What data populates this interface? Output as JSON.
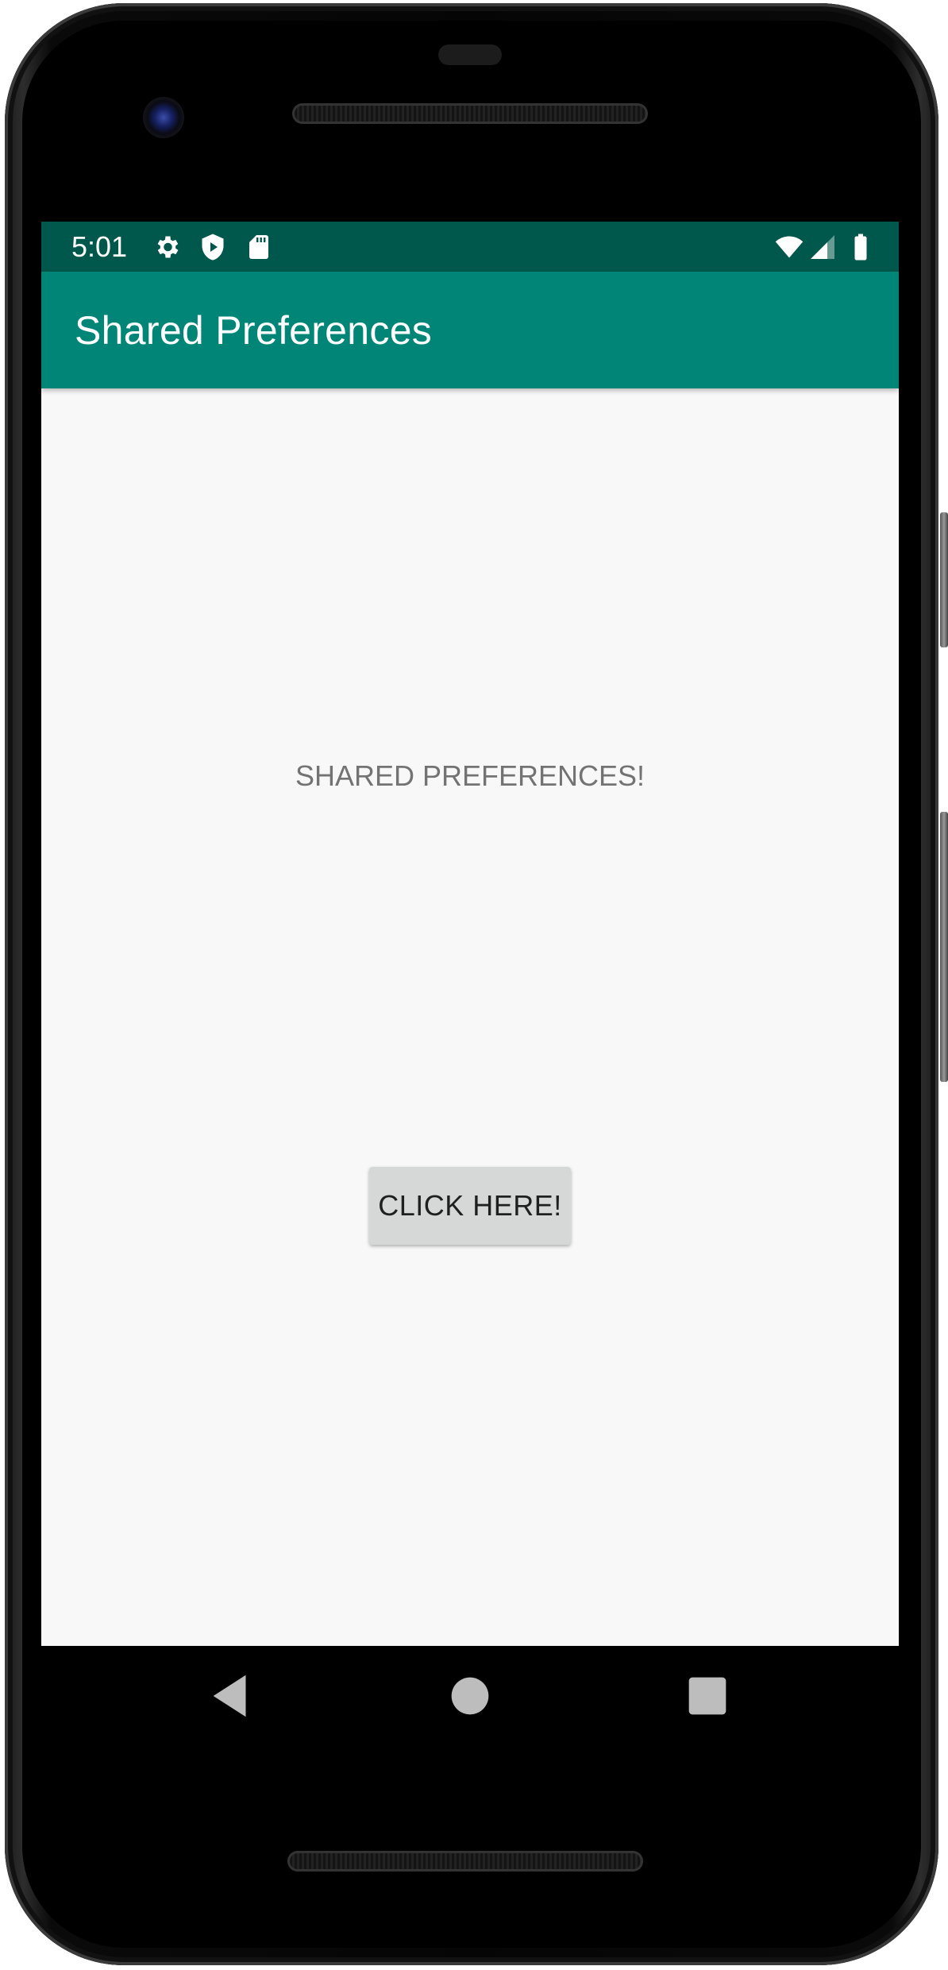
{
  "status_bar": {
    "time": "5:01",
    "left_icons": [
      "gear-icon",
      "shield-play-icon",
      "sd-card-icon"
    ],
    "right_icons": [
      "wifi-icon",
      "cell-signal-icon",
      "battery-icon"
    ],
    "background_color": "#00574b"
  },
  "app_bar": {
    "title": "Shared Preferences",
    "background_color": "#008577"
  },
  "main": {
    "label": "SHARED PREFERENCES!",
    "button_label": "CLICK HERE!"
  },
  "nav_bar": {
    "buttons": [
      "back-icon",
      "home-icon",
      "recents-icon"
    ]
  }
}
